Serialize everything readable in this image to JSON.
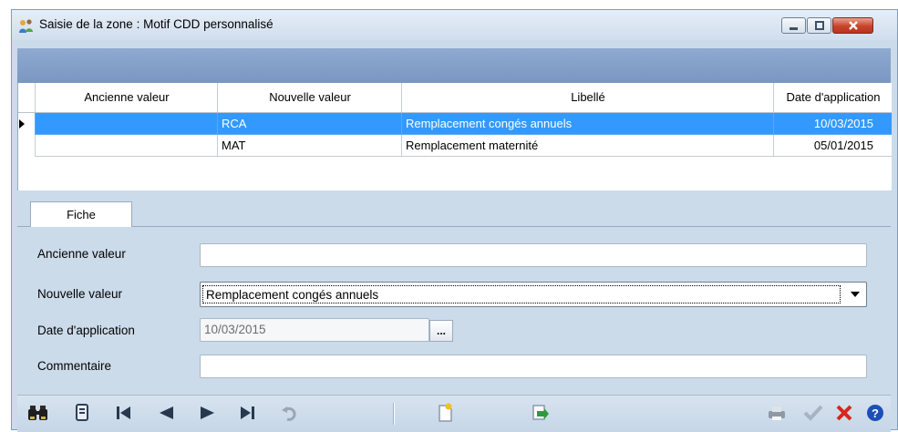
{
  "window": {
    "title": "Saisie de la zone : Motif CDD personnalisé",
    "controls": [
      "minimize-icon",
      "maximize-icon",
      "close-icon"
    ]
  },
  "grid": {
    "columns": [
      "Ancienne valeur",
      "Nouvelle valeur",
      "Libellé",
      "Date d'application"
    ],
    "rows": [
      {
        "ancienne": "",
        "nouvelle": "RCA",
        "libelle": "Remplacement congés annuels",
        "date": "10/03/2015",
        "selected": true
      },
      {
        "ancienne": "",
        "nouvelle": "MAT",
        "libelle": "Remplacement maternité",
        "date": "05/01/2015",
        "selected": false
      }
    ]
  },
  "form": {
    "tab": "Fiche",
    "ancienne_label": "Ancienne valeur",
    "ancienne_value": "",
    "nouvelle_label": "Nouvelle valeur",
    "nouvelle_value": "Remplacement congés annuels",
    "date_label": "Date d'application",
    "date_value": "10/03/2015",
    "date_button": "...",
    "commentaire_label": "Commentaire",
    "commentaire_value": ""
  },
  "toolbar": {
    "icons": [
      "binoculars-icon",
      "book-icon",
      "first-record-icon",
      "previous-record-icon",
      "next-record-icon",
      "last-record-icon",
      "undo-icon",
      "new-record-icon",
      "copy-record-icon",
      "print-icon",
      "validate-icon",
      "delete-icon",
      "help-icon"
    ]
  },
  "colors": {
    "selection": "#3399ff",
    "window_bg": "#ccdbea",
    "header_strip": "#7f9dc7"
  }
}
